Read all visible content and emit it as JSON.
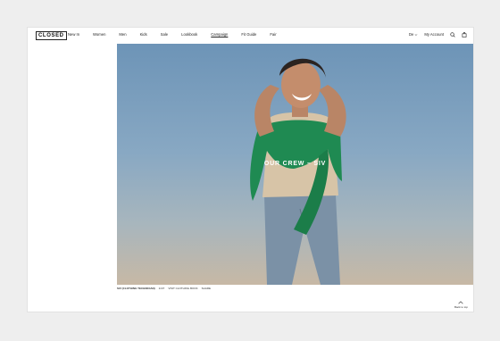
{
  "header": {
    "logo": "CLOSED",
    "menu": [
      {
        "label": "New In",
        "active": false
      },
      {
        "label": "Women",
        "active": false
      },
      {
        "label": "Men",
        "active": false
      },
      {
        "label": "Kids",
        "active": false
      },
      {
        "label": "Sale",
        "active": false
      },
      {
        "label": "Lookbook",
        "active": false
      },
      {
        "label": "Campaign",
        "active": true
      },
      {
        "label": "Fit Guide",
        "active": false
      },
      {
        "label": "Fair",
        "active": false
      }
    ],
    "language": "De",
    "account": "My Account",
    "search_icon": "search-icon",
    "bag_icon": "bag-icon"
  },
  "hero": {
    "title": "OUR CREW – SIV",
    "colors": {
      "sky_top": "#6d94b7",
      "sky_bottom": "#c7b8a5",
      "sweater": "#1f8a52"
    }
  },
  "caption": {
    "name": "SIV (CLOTHING TECHNICIAN)",
    "number": "1/4/7",
    "link1": "VISIT CLOTHING BOOK",
    "link2": "SHARE"
  },
  "back_to_top": "Back to top"
}
